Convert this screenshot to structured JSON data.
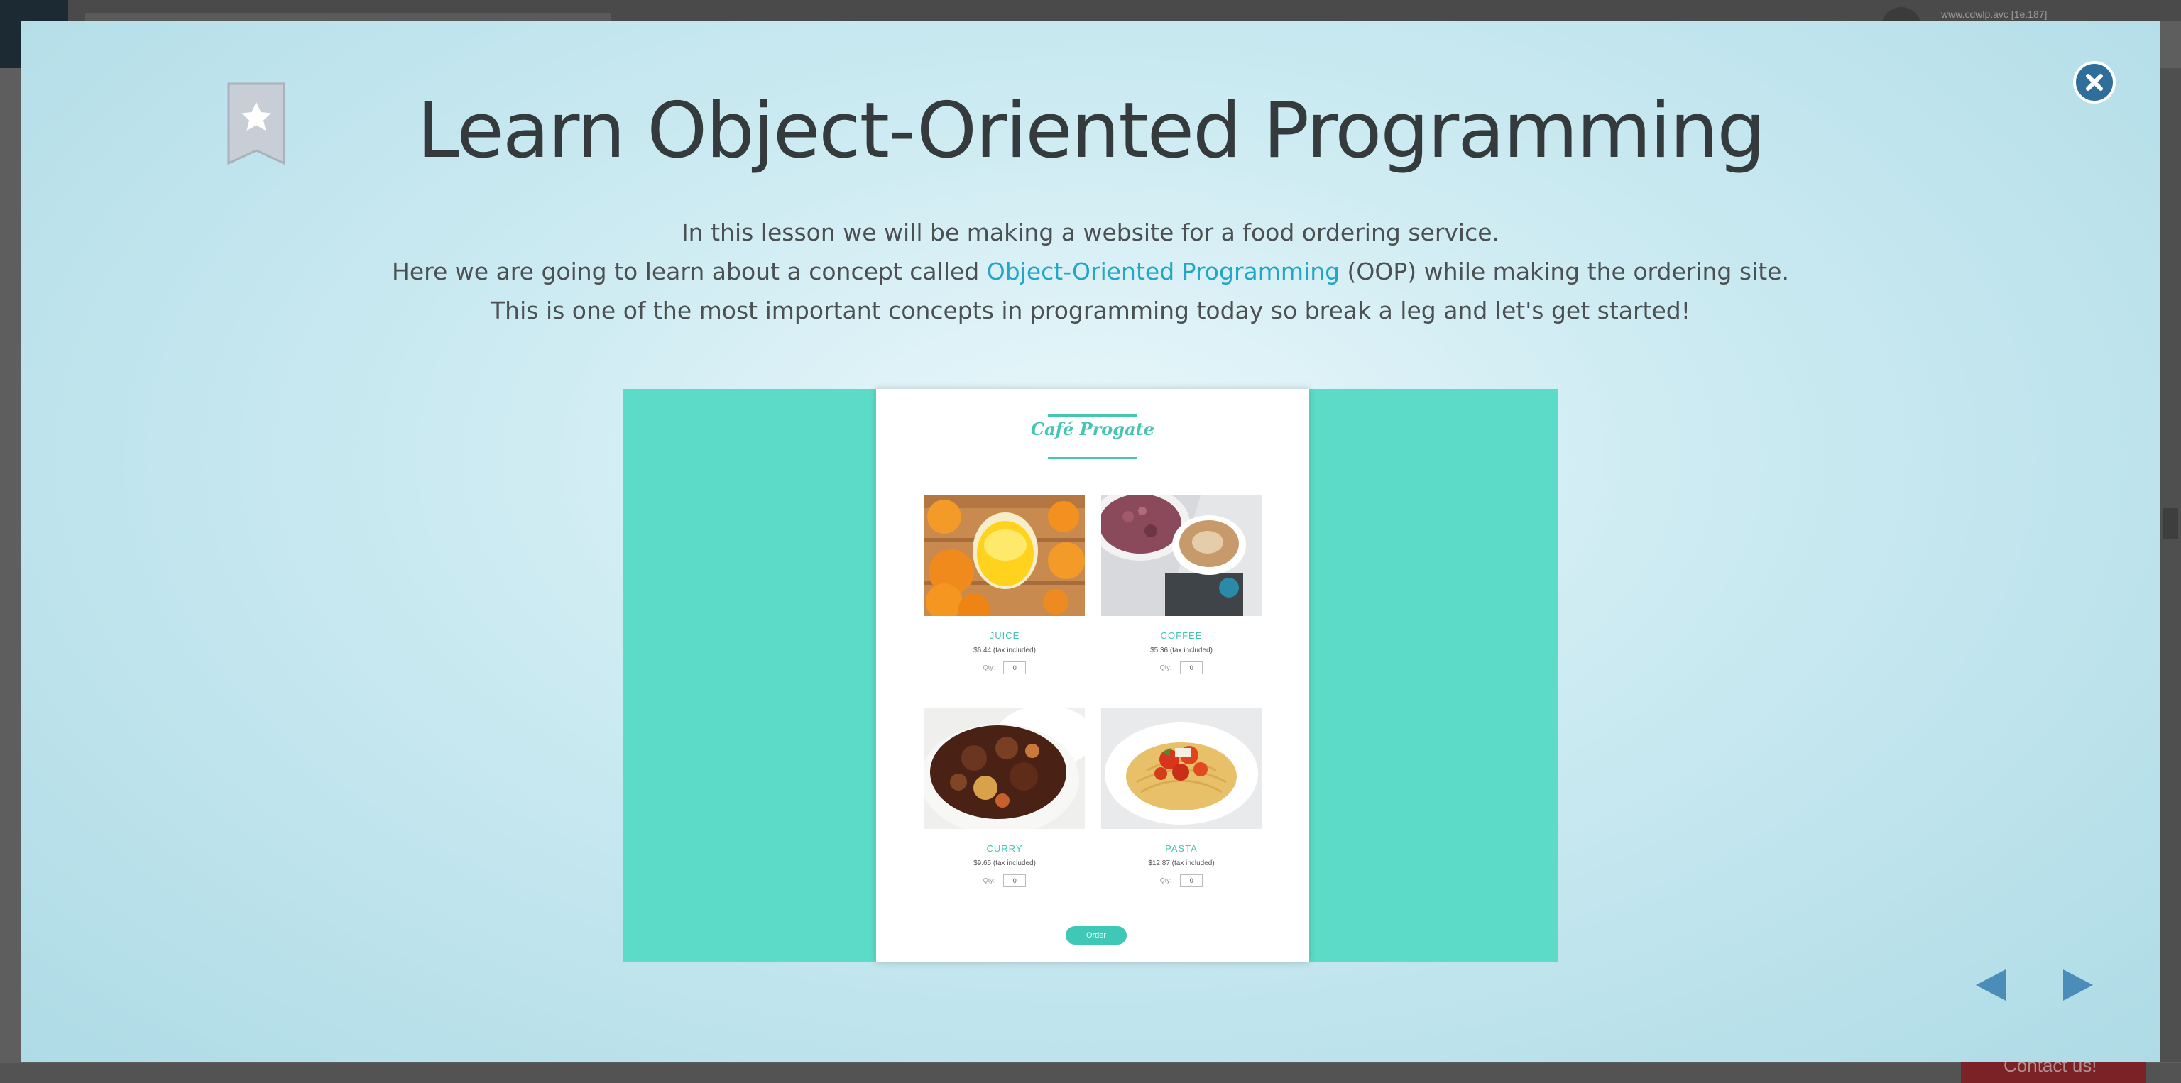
{
  "background": {
    "user_text": "www.cdwlp.avc [1e.187]",
    "contact_label": "Contact us!"
  },
  "modal": {
    "title": "Learn Object-Oriented Programming",
    "description": {
      "line1": "In this lesson we will be making a website for a food ordering service.",
      "line2_before": "Here we are going to learn about a concept called ",
      "line2_link": "Object-Oriented Programming",
      "line2_after": " (OOP) while making the ordering site.",
      "line3": "This is one of the most important concepts in programming today so break a leg and let's get started!"
    },
    "bookmark_icon": "star-bookmark-icon",
    "close_icon": "close-icon",
    "nav": {
      "prev_icon": "prev-arrow-icon",
      "next_icon": "next-arrow-icon"
    }
  },
  "preview": {
    "cafe_name": "Café Progate",
    "items": [
      {
        "name": "JUICE",
        "price": "$6.44 (tax included)",
        "qty_label": "Qty:",
        "qty": "0"
      },
      {
        "name": "COFFEE",
        "price": "$5.36 (tax included)",
        "qty_label": "Qty:",
        "qty": "0"
      },
      {
        "name": "CURRY",
        "price": "$9.65 (tax included)",
        "qty_label": "Qty:",
        "qty": "0"
      },
      {
        "name": "PASTA",
        "price": "$12.87 (tax included)",
        "qty_label": "Qty:",
        "qty": "0"
      }
    ],
    "order_label": "Order"
  },
  "colors": {
    "accent": "#22a6c5",
    "teal": "#5cdcc8",
    "close": "#2f6e9b",
    "arrow": "#4a8db9"
  }
}
